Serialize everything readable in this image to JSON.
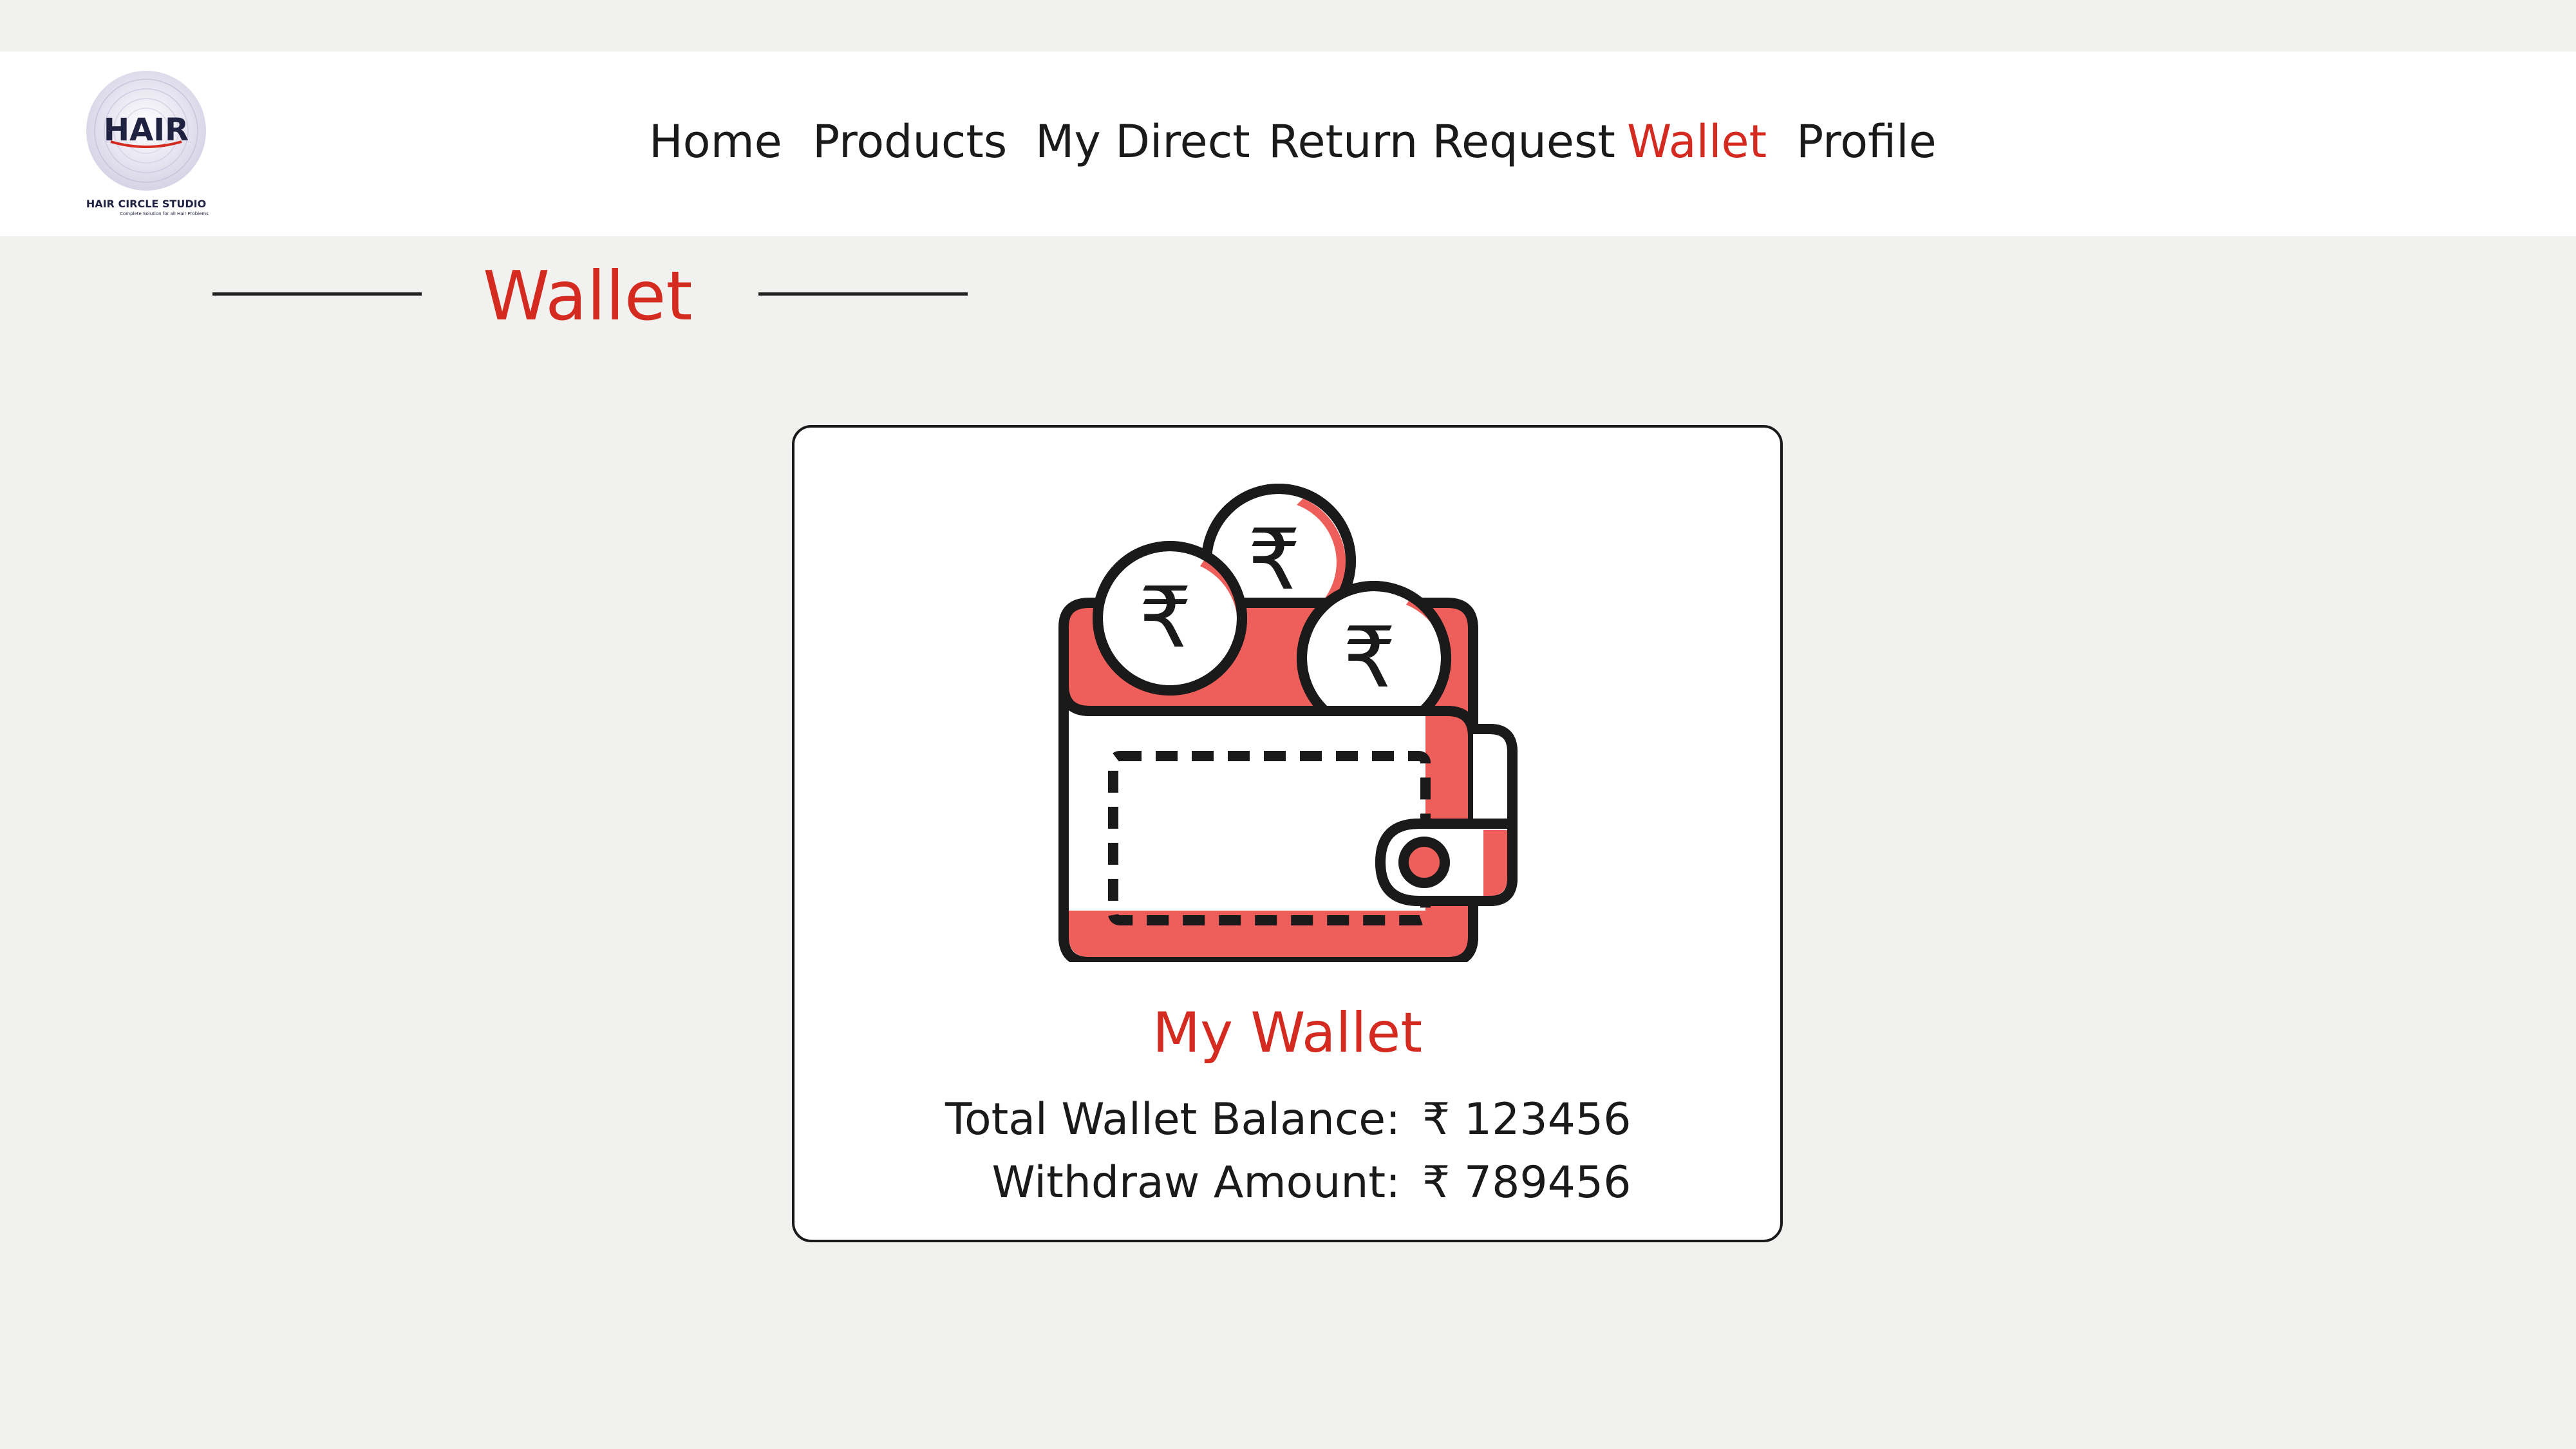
{
  "logo": {
    "brand_text": "HAIR",
    "company_name": "HAIR CIRCLE STUDIO",
    "tagline": "Complete Solution for all Hair Problems"
  },
  "nav": {
    "items": [
      {
        "label": "Home",
        "active": false
      },
      {
        "label": "Products",
        "active": false
      },
      {
        "label": "My Direct",
        "active": false
      },
      {
        "label": "Return Request",
        "active": false
      },
      {
        "label": "Wallet",
        "active": true
      },
      {
        "label": "Profile",
        "active": false
      }
    ]
  },
  "page": {
    "title": "Wallet"
  },
  "wallet_card": {
    "icon": "wallet-with-rupee-coins-icon",
    "heading": "My Wallet",
    "total_balance_label": "Total Wallet Balance:",
    "total_balance_value": "₹ 123456",
    "withdraw_label": "Withdraw Amount:",
    "withdraw_value": "₹ 789456"
  },
  "colors": {
    "accent": "#d42a1f",
    "wallet_fill": "#ee5f5b",
    "background": "#f1f1f0",
    "header": "#ffffff"
  }
}
